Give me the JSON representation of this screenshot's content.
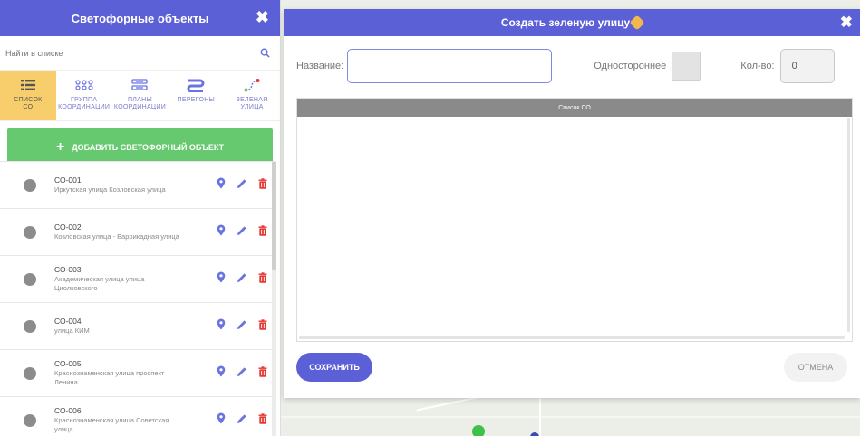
{
  "left_panel": {
    "title": "Светофорные объекты",
    "close_glyph": "✖",
    "search": {
      "placeholder": "Найти в списке",
      "value": ""
    },
    "tabs": [
      {
        "label": "Список\nСО",
        "icon": "list-icon",
        "active": true
      },
      {
        "label": "Группа\nкоординации",
        "icon": "group-icon",
        "active": false
      },
      {
        "label": "Планы\nкоординации",
        "icon": "plans-icon",
        "active": false
      },
      {
        "label": "Перегоны",
        "icon": "road-segments-icon",
        "active": false
      },
      {
        "label": "Зеленая\nулица",
        "icon": "green-street-icon",
        "active": false
      }
    ],
    "add_button": {
      "plus": "+",
      "label": "Добавить светофорный объект"
    },
    "items": [
      {
        "code": "СО-001",
        "desc": "Иркутская улица Козловская улица"
      },
      {
        "code": "СО-002",
        "desc": "Козловская улица - Баррикадная улица"
      },
      {
        "code": "СО-003",
        "desc": "Академическая улица улица Циолковского"
      },
      {
        "code": "СО-004",
        "desc": "улица КИМ"
      },
      {
        "code": "СО-005",
        "desc": "Краснознаменская улица проспект Ленина"
      },
      {
        "code": "СО-006",
        "desc": "Краснознаменская улица Советская улица"
      }
    ]
  },
  "dialog": {
    "title": "Создать зеленую улицу",
    "close_glyph": "✖",
    "name_label": "Название:",
    "name_value": "",
    "oneway_label": "Одностороннее",
    "count_label": "Кол-во:",
    "count_value": "0",
    "list_header": "Список СО",
    "save_label": "Сохранить",
    "cancel_label": "Отмена"
  },
  "colors": {
    "accent": "#5b60d6",
    "green": "#67c96f",
    "active_tab": "#f7ce6b",
    "delete": "#e53935",
    "pin": "#6a73e0"
  }
}
